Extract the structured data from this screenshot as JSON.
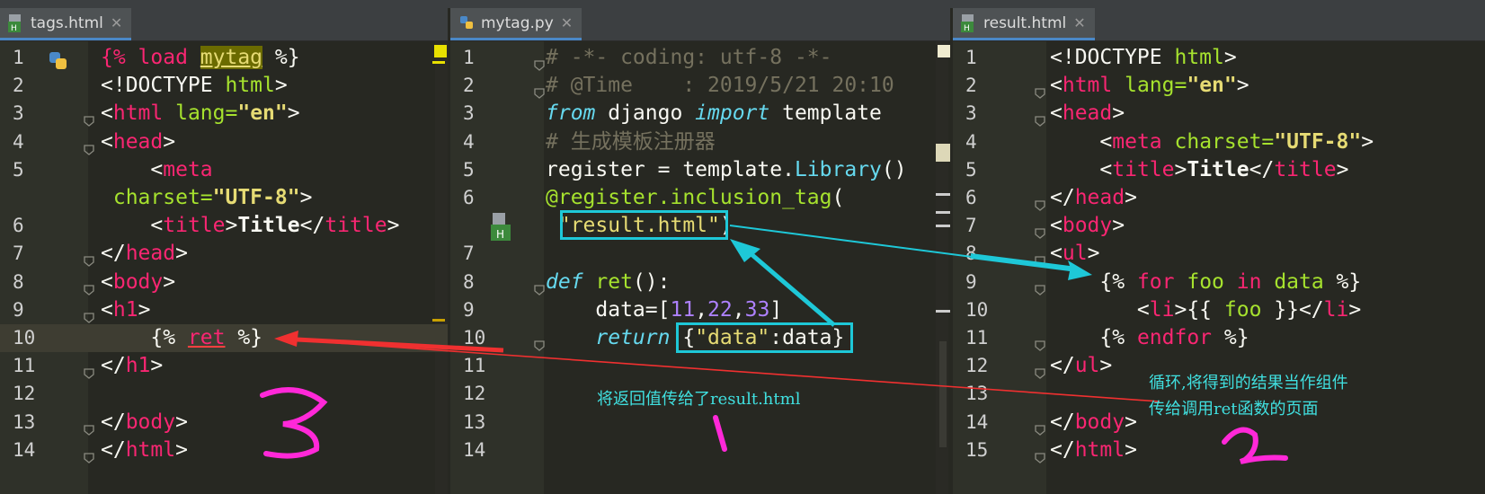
{
  "panes": [
    {
      "tab_label": "tags.html",
      "lines": [
        {
          "n": "1",
          "html": "<span class='kw'>{% load </span><span class='mytag'>mytag</span> %}"
        },
        {
          "n": "2",
          "html": "<span>&lt;!DOCTYPE </span><span class='at'>html</span>&gt;"
        },
        {
          "n": "3",
          "html": "&lt;<span class='tag'>html</span> <span class='at'>lang=</span><span class='str b'>\"en\"</span>&gt;"
        },
        {
          "n": "4",
          "html": "&lt;<span class='tag'>head</span>&gt;"
        },
        {
          "n": "5",
          "html": "    &lt;<span class='tag'>meta</span>"
        },
        {
          "n": "",
          "html": " <span class='at'>charset=</span><span class='str b'>\"UTF-8\"</span>&gt;"
        },
        {
          "n": "6",
          "html": "    &lt;<span class='tag'>title</span>&gt;<span class='b'>Title</span>&lt;/<span class='tag'>title</span>&gt;"
        },
        {
          "n": "7",
          "html": "&lt;/<span class='tag'>head</span>&gt;"
        },
        {
          "n": "8",
          "html": "&lt;<span class='tag'>body</span>&gt;"
        },
        {
          "n": "9",
          "html": "&lt;<span class='tag'>h1</span>&gt;"
        },
        {
          "n": "10",
          "html": "    {% <span class='ret'>ret</span> %}"
        },
        {
          "n": "11",
          "html": "&lt;/<span class='tag'>h1</span>&gt;"
        },
        {
          "n": "12",
          "html": ""
        },
        {
          "n": "13",
          "html": "&lt;/<span class='tag'>body</span>&gt;"
        },
        {
          "n": "14",
          "html": "&lt;/<span class='tag'>html</span>&gt;"
        }
      ]
    },
    {
      "tab_label": "mytag.py",
      "lines": [
        {
          "n": "1",
          "html": "<span class='cm'># -*- coding: utf-8 -*-</span>"
        },
        {
          "n": "2",
          "html": "<span class='cm'># @Time    : 2019/5/21 20:10</span>"
        },
        {
          "n": "3",
          "html": "<span class='it'>from</span> django <span class='it'>import</span> template"
        },
        {
          "n": "4",
          "html": "<span class='cm'># 生成模板注册器</span>"
        },
        {
          "n": "5",
          "html": "register = template.<span class='lib'>Library</span>()"
        },
        {
          "n": "6",
          "html": "<span class='dec'>@register.inclusion_tag</span>("
        },
        {
          "n": "",
          "html": " <span class='str'>\"result.html\"</span>)"
        },
        {
          "n": "7",
          "html": ""
        },
        {
          "n": "8",
          "html": "<span class='it'>def</span> <span class='fn'>ret</span>():"
        },
        {
          "n": "9",
          "html": "    data=[<span class='num'>11</span>,<span class='num'>22</span>,<span class='num'>33</span>]"
        },
        {
          "n": "10",
          "html": "    <span class='it'>return</span> {<span class='str'>\"data\"</span>:data}"
        },
        {
          "n": "11",
          "html": ""
        },
        {
          "n": "12",
          "html": ""
        },
        {
          "n": "13",
          "html": ""
        },
        {
          "n": "14",
          "html": ""
        }
      ]
    },
    {
      "tab_label": "result.html",
      "lines": [
        {
          "n": "1",
          "html": "&lt;!DOCTYPE <span class='at'>html</span>&gt;"
        },
        {
          "n": "2",
          "html": "&lt;<span class='tag'>html</span> <span class='at'>lang=</span><span class='str b'>\"en\"</span>&gt;"
        },
        {
          "n": "3",
          "html": "&lt;<span class='tag'>head</span>&gt;"
        },
        {
          "n": "4",
          "html": "    &lt;<span class='tag'>meta</span> <span class='at'>charset=</span><span class='str b'>\"UTF-8\"</span>&gt;"
        },
        {
          "n": "5",
          "html": "    &lt;<span class='tag'>title</span>&gt;<span class='b'>Title</span>&lt;/<span class='tag'>title</span>&gt;"
        },
        {
          "n": "6",
          "html": "&lt;/<span class='tag'>head</span>&gt;"
        },
        {
          "n": "7",
          "html": "&lt;<span class='tag'>body</span>&gt;"
        },
        {
          "n": "8",
          "html": "&lt;<span class='tag'>ul</span>&gt;"
        },
        {
          "n": "9",
          "html": "    {% <span class='kw'>for</span> <span class='at'>foo</span> <span class='kw'>in</span> <span class='at'>data</span> %}"
        },
        {
          "n": "10",
          "html": "       &lt;<span class='tag'>li</span>&gt;{{ <span class='at'>foo</span> }}&lt;/<span class='tag'>li</span>&gt;"
        },
        {
          "n": "11",
          "html": "    {% <span class='kw'>endfor</span> %}"
        },
        {
          "n": "12",
          "html": "&lt;/<span class='tag'>ul</span>&gt;"
        },
        {
          "n": "13",
          "html": ""
        },
        {
          "n": "14",
          "html": "&lt;/<span class='tag'>body</span>&gt;"
        },
        {
          "n": "15",
          "html": "&lt;/<span class='tag'>html</span>&gt;"
        }
      ]
    }
  ],
  "annotations": {
    "pass_result": "将返回值传给了result.html",
    "loop_note_line1": "循环,将得到的结果当作组件",
    "loop_note_line2": "传给调用ret函数的页面"
  },
  "icons": {
    "html_file": "html-file-icon",
    "python_file": "python-file-icon"
  },
  "colors": {
    "arrow_cyan": "#1ec8d8",
    "arrow_red": "#f03030",
    "handwriting": "#ff28d8"
  }
}
